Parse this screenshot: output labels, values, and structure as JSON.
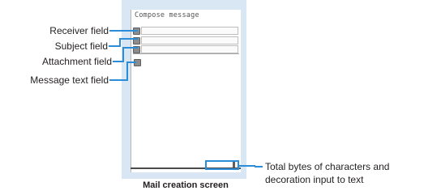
{
  "screen": {
    "title": "Compose message"
  },
  "callouts": {
    "receiver": "Receiver field",
    "subject": "Subject field",
    "attachment": "Attachment field",
    "message_text": "Message text field",
    "total_bytes_line1": "Total bytes of characters and",
    "total_bytes_line2": "decoration input to text"
  },
  "caption": "Mail creation screen",
  "colors": {
    "callout_line": "#2b8cd8",
    "frame_background": "#d9e7f4"
  }
}
